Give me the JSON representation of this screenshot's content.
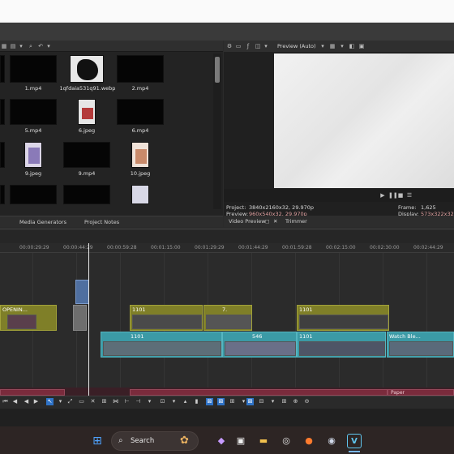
{
  "media_panel": {
    "items": [
      {
        "label": "1.mp4"
      },
      {
        "label": "1qfdaia531q91.webp"
      },
      {
        "label": "2.mp4"
      },
      {
        "label": "5.mp4"
      },
      {
        "label": "6.jpeg"
      },
      {
        "label": "6.mp4"
      },
      {
        "label": "9.jpeg"
      },
      {
        "label": "9.mp4"
      },
      {
        "label": "10.jpeg"
      }
    ],
    "tabs": [
      "Media Generators",
      "Project Notes"
    ]
  },
  "preview": {
    "mode_label": "Preview (Auto)",
    "project_label": "Project:",
    "project_value": "3840x2160x32, 29.970p",
    "preview_label": "Preview:",
    "preview_value": "960x540x32, 29.970p",
    "frame_label": "Frame:",
    "frame_value": "1,625",
    "display_label": "Display:",
    "display_value": "573x322x32",
    "tabs": [
      "Video Preview",
      "Trimmer"
    ]
  },
  "timeline": {
    "timecodes": [
      "00:00:29:29",
      "00:00:44:29",
      "00:00:59:28",
      "00:01:15:00",
      "00:01:29:29",
      "00:01:44:29",
      "00:01:59:28",
      "00:02:15:00",
      "00:02:30:00",
      "00:02:44:29"
    ],
    "clips_top": [
      {
        "label": "OPENIN..."
      },
      {
        "label": "1101"
      },
      {
        "label": "7."
      },
      {
        "label": "1101"
      }
    ],
    "clips_bottom": [
      {
        "label": "1101"
      },
      {
        "label": "546"
      },
      {
        "label": "1101"
      },
      {
        "label": "Watch Ble..."
      }
    ],
    "audio_label": "Paper"
  },
  "taskbar": {
    "search_placeholder": "Search"
  },
  "colors": {
    "video_clip_olive": "#7f7f28",
    "video_clip_teal": "#3b9aa6",
    "audio_clip": "#7a2b3c",
    "accent_blue": "#2f73c7"
  }
}
